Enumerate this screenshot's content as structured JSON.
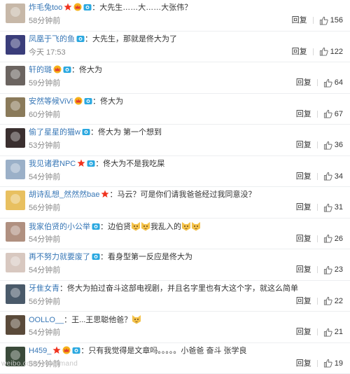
{
  "comments": [
    {
      "username": "炸毛兔too",
      "badges": [
        "star-badge",
        "vip-crown-badge",
        "camera-badge"
      ],
      "text": "：大先生……大……大张伟？",
      "time": "58分钟前",
      "reply": "回复",
      "likes": "156",
      "avatar_color": "#c7b8a8"
    },
    {
      "username": "凤凰于飞的鱼",
      "badges": [
        "camera-badge"
      ],
      "text": "：大先生，那就是佟大为了",
      "time": "今天 17:53",
      "reply": "回复",
      "likes": "122",
      "avatar_color": "#3a3d7a"
    },
    {
      "username": "轩的璐",
      "badges": [
        "vip-crown-badge",
        "camera-badge"
      ],
      "text": "：佟大为",
      "time": "59分钟前",
      "reply": "回复",
      "likes": "64",
      "avatar_color": "#6b6460"
    },
    {
      "username": "安然等候ViVi",
      "badges": [
        "vip-crown-badge",
        "camera-badge"
      ],
      "text": "：佟大为",
      "time": "60分钟前",
      "reply": "回复",
      "likes": "67",
      "avatar_color": "#8a7a5a"
    },
    {
      "username": "偷了星星的猫w",
      "badges": [
        "camera-badge"
      ],
      "text": "：佟大为   第一个想到",
      "time": "53分钟前",
      "reply": "回复",
      "likes": "36",
      "avatar_color": "#3a2f2f"
    },
    {
      "username": "我见诸君NPC",
      "badges": [
        "star-badge",
        "camera-badge"
      ],
      "text": "：佟大为不是我吃屎",
      "time": "54分钟前",
      "reply": "回复",
      "likes": "34",
      "avatar_color": "#9bb0c8"
    },
    {
      "username": "胡诗乱想_然然然bae",
      "badges": [
        "star-badge"
      ],
      "text": "：马云？可是你们请我爸爸经过我同意没？",
      "time": "56分钟前",
      "reply": "回复",
      "likes": "31",
      "avatar_color": "#e8c060"
    },
    {
      "username": "我家伯贤的小公举",
      "badges": [
        "camera-badge"
      ],
      "text": "：边伯贤",
      "text2": "我乱入的",
      "time": "54分钟前",
      "reply": "回复",
      "likes": "26",
      "avatar_color": "#b09080"
    },
    {
      "username": "再不努力就要废了",
      "badges": [
        "camera-badge"
      ],
      "text": "：看身型第一反应是佟大为",
      "time": "54分钟前",
      "reply": "回复",
      "likes": "23",
      "avatar_color": "#d8c8c0"
    },
    {
      "username": "牙隹女青",
      "badges": [],
      "text": "：佟大为拍过奋斗这部电视剧，并且名字里也有大这个字，就这么简单",
      "time": "56分钟前",
      "reply": "回复",
      "likes": "22",
      "avatar_color": "#4a5a6a"
    },
    {
      "username": "OOLLO__",
      "badges": [],
      "text": "：王...王思聪他爸？",
      "time": "54分钟前",
      "reply": "回复",
      "likes": "21",
      "avatar_color": "#5a4a3a"
    },
    {
      "username": "H459_",
      "badges": [
        "star-badge",
        "vip-crown-badge",
        "camera-badge"
      ],
      "text": "：只有我觉得是文章吗。。。。。小爸爸  奋斗  张学良",
      "time": "58分钟前",
      "reply": "回复",
      "likes": "19",
      "avatar_color": "#3a4a3a"
    }
  ],
  "watermark": "weibo.com/recommand",
  "colors": {
    "username": "#3877b6",
    "time": "#888888",
    "border": "#eceef0"
  }
}
